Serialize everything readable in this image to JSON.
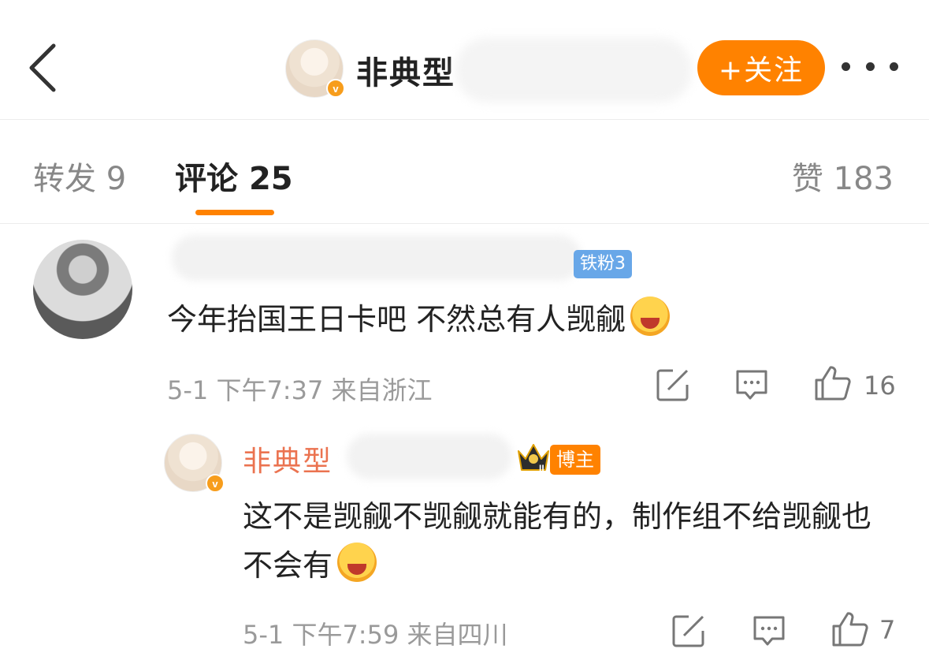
{
  "header": {
    "name_visible": "非典型",
    "follow_label": "+关注",
    "verified_mark": "v"
  },
  "tabs": [
    {
      "label": "转发",
      "count": "9"
    },
    {
      "label": "评论",
      "count": "25"
    },
    {
      "label": "赞",
      "count": "183"
    }
  ],
  "comments": [
    {
      "badge": "铁粉3",
      "text": "今年抬国王日卡吧 不然总有人觊觎",
      "emoji": "laughing-crying",
      "time": "5-1 下午7:37",
      "location": "来自浙江",
      "likes": "16"
    },
    {
      "name_visible": "非典型",
      "badge": "博主",
      "crown_level": "II",
      "text": "这不是觊觎不觊觎就能有的，制作组不给觊觎也不会有",
      "emoji": "tears-of-joy",
      "time": "5-1 下午7:59",
      "location": "来自四川",
      "likes": "7"
    }
  ],
  "colors": {
    "accent": "#ff8200",
    "name_orange": "#eb7350",
    "fan_badge_blue": "#68a7e8"
  }
}
